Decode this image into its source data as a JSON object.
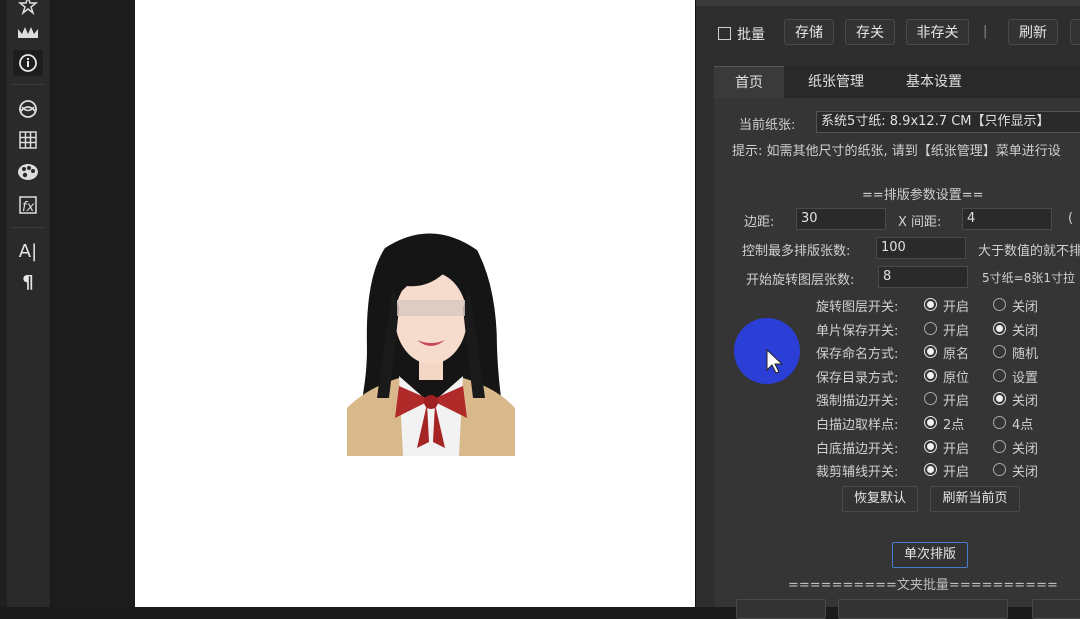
{
  "toolbar": {
    "tools": [
      "star-icon",
      "crown-icon",
      "info-icon",
      "cloud-icon",
      "grid-icon",
      "palette-icon",
      "effects-icon",
      "text-icon",
      "paragraph-icon"
    ],
    "text_tool": "A|",
    "paragraph_tool": "¶"
  },
  "panel": {
    "top": {
      "batch_label": "批量",
      "save_btn": "存储",
      "save_close_btn": "存关",
      "nonsave_close_btn": "非存关",
      "separator": "|",
      "refresh_btn": "刷新"
    },
    "tabs": [
      "首页",
      "纸张管理",
      "基本设置"
    ],
    "paper": {
      "label": "当前纸张:",
      "value": "系统5寸纸: 8.9x12.7 CM【只作显示】",
      "hint": "提示: 如需其他尺寸的纸张, 请到【纸张管理】菜单进行设"
    },
    "layout": {
      "heading": "==排版参数设置==",
      "margin_label": "边距:",
      "margin_value": "30",
      "xgap_label": "X 间距:",
      "xgap_value": "4",
      "xgap_suffix": "(",
      "max_count_label": "控制最多排版张数:",
      "max_count_value": "100",
      "max_count_note": "大于数值的就不排",
      "rotate_count_label": "开始旋转图层张数:",
      "rotate_count_value": "8",
      "rotate_count_note": "5寸纸=8张1寸拉"
    },
    "options": [
      {
        "label": "旋转图层开关:",
        "a": "开启",
        "b": "关闭",
        "selected": "a"
      },
      {
        "label": "单片保存开关:",
        "a": "开启",
        "b": "关闭",
        "selected": "b"
      },
      {
        "label": "保存命名方式:",
        "a": "原名",
        "b": "随机",
        "selected": "a"
      },
      {
        "label": "保存目录方式:",
        "a": "原位",
        "b": "设置",
        "selected": "a"
      },
      {
        "label": "强制描边开关:",
        "a": "开启",
        "b": "关闭",
        "selected": "b"
      },
      {
        "label": "白描边取样点:",
        "a": "2点",
        "b": "4点",
        "selected": "a"
      },
      {
        "label": "白底描边开关:",
        "a": "开启",
        "b": "关闭",
        "selected": "a"
      },
      {
        "label": "裁剪辅线开关:",
        "a": "开启",
        "b": "关闭",
        "selected": "a"
      }
    ],
    "restore_btn": "恢复默认",
    "refresh_page_btn": "刷新当前页",
    "single_layout_btn": "单次排版",
    "folder_batch": "==========文夹批量=========="
  }
}
